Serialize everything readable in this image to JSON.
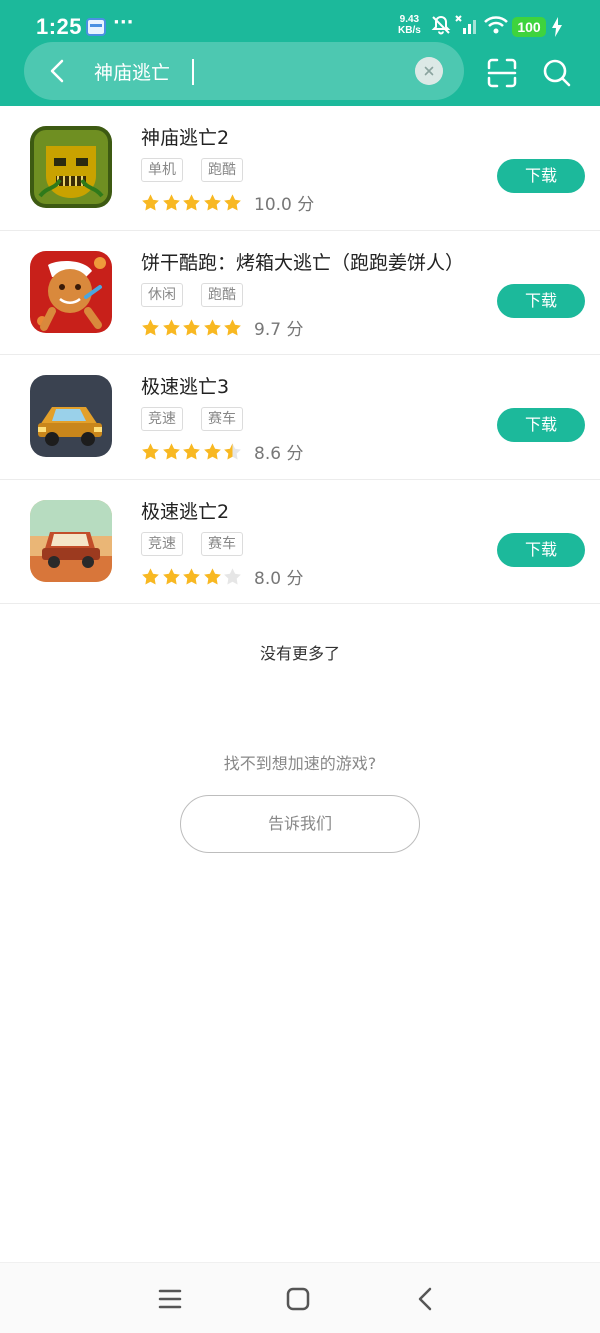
{
  "status": {
    "time": "1:25",
    "dots": "···",
    "net_speed_value": "9.43",
    "net_speed_unit": "KB/s",
    "battery": "100"
  },
  "search": {
    "query": "神庙逃亡",
    "icons": [
      "back-arrow-icon",
      "clear-icon",
      "scan-icon",
      "search-icon"
    ]
  },
  "results": [
    {
      "name": "神庙逃亡2",
      "tags": [
        "单机",
        "跑酷"
      ],
      "stars": 5,
      "score": "10.0 分",
      "button": "下载",
      "icon_colors": [
        "#5b7a1a",
        "#d8b000"
      ]
    },
    {
      "name": "饼干酷跑：烤箱大逃亡（跑跑姜饼人）",
      "tags": [
        "休闲",
        "跑酷"
      ],
      "stars": 5,
      "score": "9.7 分",
      "button": "下载",
      "icon_colors": [
        "#c9221b",
        "#d98a3e"
      ]
    },
    {
      "name": "极速逃亡3",
      "tags": [
        "竞速",
        "赛车"
      ],
      "stars": 4.5,
      "score": "8.6 分",
      "button": "下载",
      "icon_colors": [
        "#3a4250",
        "#e9a12b"
      ]
    },
    {
      "name": "极速逃亡2",
      "tags": [
        "竞速",
        "赛车"
      ],
      "stars": 4,
      "score": "8.0 分",
      "button": "下载",
      "icon_colors": [
        "#eab676",
        "#c45a2a"
      ]
    }
  ],
  "footer": {
    "no_more": "没有更多了",
    "missing_question": "找不到想加速的游戏?",
    "tell_us": "告诉我们"
  },
  "colors": {
    "accent": "#1cb99b",
    "star": "#f8b822",
    "star_empty": "#e6e6e6"
  }
}
